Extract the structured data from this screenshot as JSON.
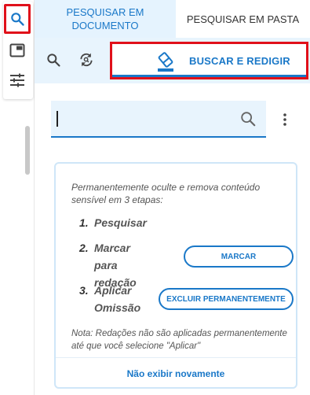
{
  "rail": {
    "items": [
      {
        "icon": "search-icon"
      },
      {
        "icon": "panel-icon"
      },
      {
        "icon": "filter-icon"
      }
    ]
  },
  "tabs": [
    {
      "label": "PESQUISAR EM DOCUMENTO",
      "active": true
    },
    {
      "label": "PESQUISAR EM PASTA",
      "active": false
    }
  ],
  "toolbar": {
    "search_icon": "search-icon",
    "refresh_icon": "refresh-search-icon",
    "redact_label": "BUSCAR E REDIGIR"
  },
  "search": {
    "value": ""
  },
  "card": {
    "intro": "Permanentemente oculte e remova conteúdo sensível em 3 etapas:",
    "steps": [
      {
        "num": "1.",
        "text": "Pesquisar"
      },
      {
        "num": "2.",
        "text": "Marcar para\nredação",
        "button": "MARCAR"
      },
      {
        "num": "3.",
        "text": "Aplicar\nOmissão",
        "button": "EXCLUIR PERMANENTEMENTE"
      }
    ],
    "note": "Nota: Redações não são aplicadas permanentemente até que você selecione \"Aplicar\"",
    "dismiss": "Não exibir novamente"
  },
  "colors": {
    "accent": "#1a78c8",
    "highlight": "#e0101a",
    "toolbar_bg": "#e8f4fd"
  }
}
